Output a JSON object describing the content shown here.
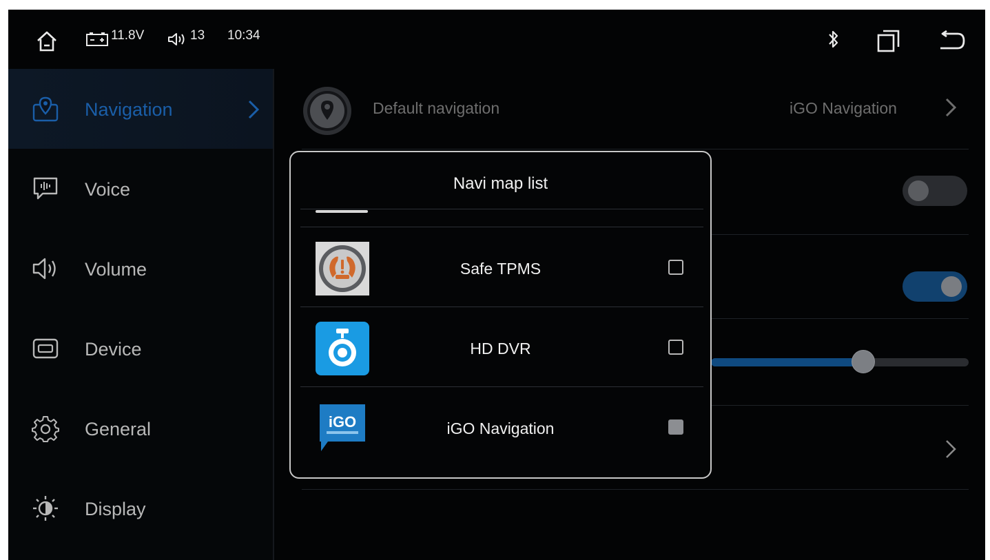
{
  "status_bar": {
    "voltage": "11.8V",
    "volume": "13",
    "time": "10:34",
    "icons": [
      "home-icon",
      "battery-icon",
      "volume-icon",
      "bluetooth-icon",
      "recents-icon",
      "back-icon"
    ]
  },
  "sidebar": {
    "items": [
      {
        "label": "Navigation",
        "icon": "map-pin-icon",
        "active": true
      },
      {
        "label": "Voice",
        "icon": "voice-bubble-icon",
        "active": false
      },
      {
        "label": "Volume",
        "icon": "speaker-icon",
        "active": false
      },
      {
        "label": "Device",
        "icon": "device-icon",
        "active": false
      },
      {
        "label": "General",
        "icon": "gear-icon",
        "active": false
      },
      {
        "label": "Display",
        "icon": "brightness-icon",
        "active": false
      }
    ]
  },
  "settings": {
    "default_navigation_label": "Default navigation",
    "default_navigation_value": "iGO Navigation",
    "toggle_1_on": false,
    "toggle_2_on": true,
    "slider_fraction": 0.59
  },
  "dialog": {
    "title": "Navi map list",
    "apps": [
      {
        "label": "Safe TPMS",
        "icon": "tpms-icon",
        "checked": false
      },
      {
        "label": "HD DVR",
        "icon": "dvr-camera-icon",
        "checked": false
      },
      {
        "label": "iGO Navigation",
        "icon": "igo-logo-icon",
        "checked": true
      }
    ],
    "igo_logo_text": "iGO"
  },
  "colors": {
    "background": "#030405",
    "accent_blue": "#1a5ea8",
    "toggle_on": "#11416e",
    "text_light": "#f0f0f0",
    "text_dim": "#6e6e6e"
  }
}
